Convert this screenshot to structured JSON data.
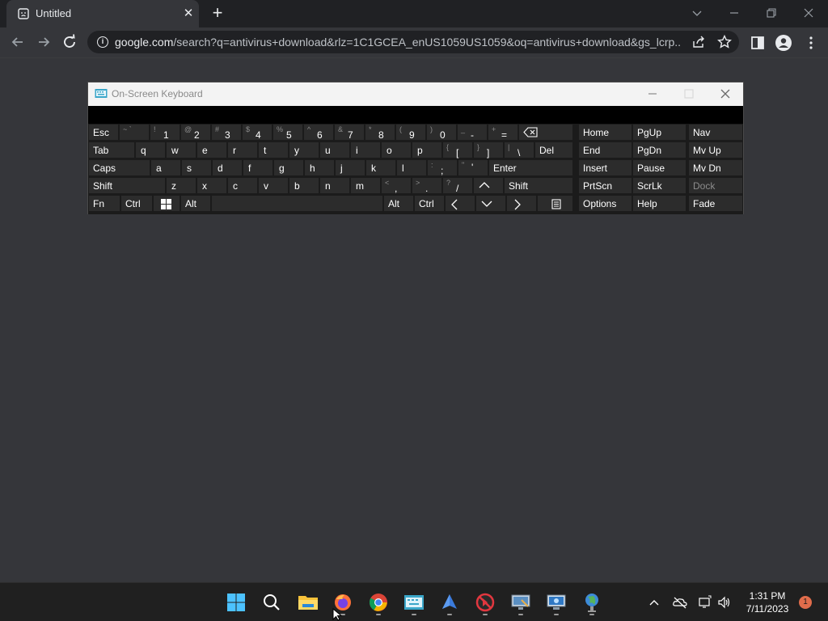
{
  "browser": {
    "tab_title": "Untitled",
    "tab_close": "✕",
    "new_tab": "+",
    "url_host": "google.com",
    "url_path": "/search?q=antivirus+download&rlz=1C1GCEA_enUS1059US1059&oq=antivirus+download&gs_lcrp...",
    "info_glyph": "i"
  },
  "osk": {
    "title": "On-Screen Keyboard",
    "rows": {
      "r1": {
        "esc": "Esc",
        "tilde_sub": "~ `",
        "k1": {
          "sub": "!",
          "main": "1"
        },
        "k2": {
          "sub": "@",
          "main": "2"
        },
        "k3": {
          "sub": "#",
          "main": "3"
        },
        "k4": {
          "sub": "$",
          "main": "4"
        },
        "k5": {
          "sub": "%",
          "main": "5"
        },
        "k6": {
          "sub": "^",
          "main": "6"
        },
        "k7": {
          "sub": "&",
          "main": "7"
        },
        "k8": {
          "sub": "*",
          "main": "8"
        },
        "k9": {
          "sub": "(",
          "main": "9"
        },
        "k0": {
          "sub": ")",
          "main": "0"
        },
        "minus": {
          "sub": "_",
          "main": "-"
        },
        "equals": {
          "sub": "+",
          "main": "="
        }
      },
      "r2": {
        "tab": "Tab",
        "letters": [
          "q",
          "w",
          "e",
          "r",
          "t",
          "y",
          "u",
          "i",
          "o",
          "p"
        ],
        "lbracket": {
          "sub": "{",
          "main": "["
        },
        "rbracket": {
          "sub": "}",
          "main": "]"
        },
        "backslash": {
          "sub": "|",
          "main": "\\"
        },
        "del": "Del"
      },
      "r3": {
        "caps": "Caps",
        "letters": [
          "a",
          "s",
          "d",
          "f",
          "g",
          "h",
          "j",
          "k",
          "l"
        ],
        "semicolon": {
          "sub": ":",
          "main": ";"
        },
        "quote": {
          "sub": "\"",
          "main": "'"
        },
        "enter": "Enter"
      },
      "r4": {
        "shift_left": "Shift",
        "letters": [
          "z",
          "x",
          "c",
          "v",
          "b",
          "n",
          "m"
        ],
        "comma": {
          "sub": "<",
          "main": ","
        },
        "period": {
          "sub": ">",
          "main": "."
        },
        "slash": {
          "sub": "?",
          "main": "/"
        },
        "shift_right": "Shift"
      },
      "r5": {
        "fn": "Fn",
        "ctrl_left": "Ctrl",
        "alt_left": "Alt",
        "alt_right": "Alt",
        "ctrl_right": "Ctrl"
      }
    },
    "nav_keys": {
      "home": "Home",
      "pgup": "PgUp",
      "nav": "Nav",
      "end": "End",
      "pgdn": "PgDn",
      "mvup": "Mv Up",
      "insert": "Insert",
      "pause": "Pause",
      "mvdn": "Mv Dn",
      "prtscn": "PrtScn",
      "scrlk": "ScrLk",
      "dock": "Dock",
      "options": "Options",
      "help": "Help",
      "fade": "Fade"
    }
  },
  "taskbar": {
    "time": "1:31 PM",
    "date": "7/11/2023",
    "notification_count": "1"
  },
  "colors": {
    "browser_bg": "#35363a",
    "tabstrip": "#202124",
    "key_bg": "#2c2c2c",
    "taskbar": "#202020"
  }
}
